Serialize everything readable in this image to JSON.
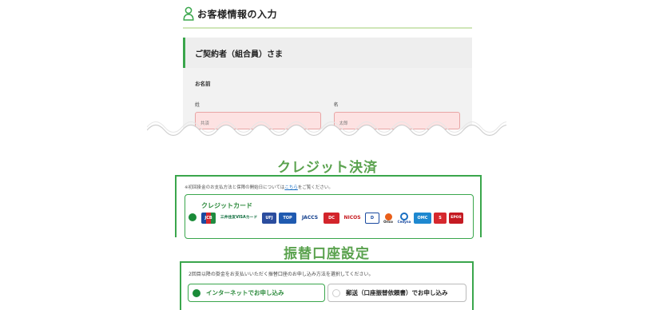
{
  "page_header": {
    "title": "お客様情報の入力",
    "icon": "person-outline-icon",
    "accent": "#3aa64c"
  },
  "contract": {
    "heading": "ご契約者（組合員）さま",
    "name_label": "お名前",
    "last_name": {
      "label": "姓",
      "placeholder": "共済"
    },
    "first_name": {
      "label": "名",
      "placeholder": "太郎"
    }
  },
  "credit": {
    "title": "クレジット決済",
    "notice_before": "※初回掛金のお支払方法と保障の開始日については",
    "notice_link": "こちら",
    "notice_after": "をご覧ください。",
    "option_label": "クレジットカード",
    "selected": true,
    "logos": [
      {
        "name": "jcb-logo",
        "text": "JCB"
      },
      {
        "name": "smbc-visa-logo",
        "text": "三井住友VISAカード"
      },
      {
        "name": "ufj-card-logo",
        "text": "UFJ"
      },
      {
        "name": "top-card-logo",
        "text": "TOP"
      },
      {
        "name": "jaccs-logo",
        "text": "JACCS"
      },
      {
        "name": "dc-logo",
        "text": "DC"
      },
      {
        "name": "nicos-logo",
        "text": "NICOS"
      },
      {
        "name": "diners-logo",
        "text": "D"
      },
      {
        "name": "orico-logo",
        "text": "Orico"
      },
      {
        "name": "cedyna-logo",
        "text": "Cedyna"
      },
      {
        "name": "omc-logo",
        "text": "OMC"
      },
      {
        "name": "saison-logo",
        "text": "S"
      },
      {
        "name": "epos-logo",
        "text": "EPOS"
      }
    ]
  },
  "bank": {
    "title": "振替口座設定",
    "notice": "2回目以降の掛金をお支払いいただく振替口座のお申し込み方法を選択してください。",
    "options": [
      {
        "label": "インターネットでお申し込み",
        "selected": true
      },
      {
        "label": "郵送（口座振替依頼書）でお申し込み",
        "selected": false
      }
    ]
  }
}
